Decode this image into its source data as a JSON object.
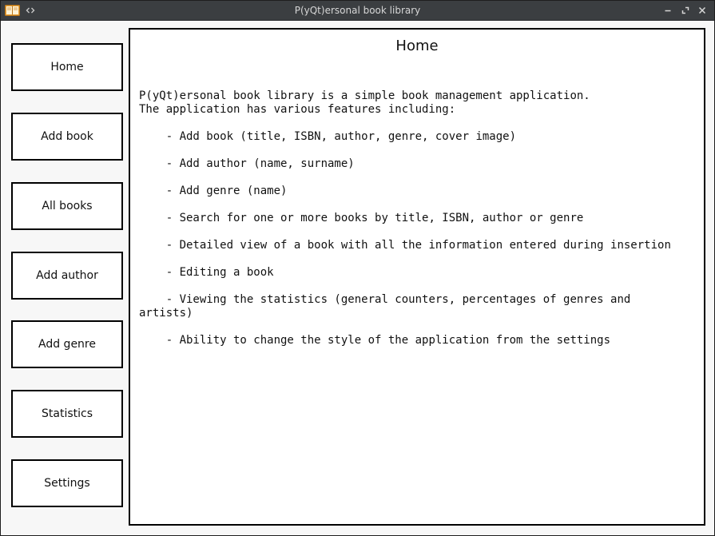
{
  "window": {
    "title": "P(yQt)ersonal book library"
  },
  "nav": {
    "items": [
      {
        "label": "Home"
      },
      {
        "label": "Add book"
      },
      {
        "label": "All books"
      },
      {
        "label": "Add author"
      },
      {
        "label": "Add genre"
      },
      {
        "label": "Statistics"
      },
      {
        "label": "Settings"
      }
    ]
  },
  "content": {
    "title": "Home",
    "intro_line_1": "P(yQt)ersonal book library is a simple book management application.",
    "intro_line_2": "The application has various features including:",
    "features": [
      "    - Add book (title, ISBN, author, genre, cover image)",
      "    - Add author (name, surname)",
      "    - Add genre (name)",
      "    - Search for one or more books by title, ISBN, author or genre",
      "    - Detailed view of a book with all the information entered during insertion",
      "    - Editing a book",
      "    - Viewing the statistics (general counters, percentages of genres and artists)",
      "    - Ability to change the style of the application from the settings"
    ]
  },
  "colors": {
    "titlebar": "#3b3e41",
    "window_bg": "#f7f7f7",
    "panel_bg": "#ffffff",
    "border": "#000000"
  },
  "icons": {
    "app": "book-icon",
    "arrows": "left-right-arrows-icon",
    "minimize": "minimize-icon",
    "maximize": "maximize-icon",
    "close": "close-icon"
  }
}
